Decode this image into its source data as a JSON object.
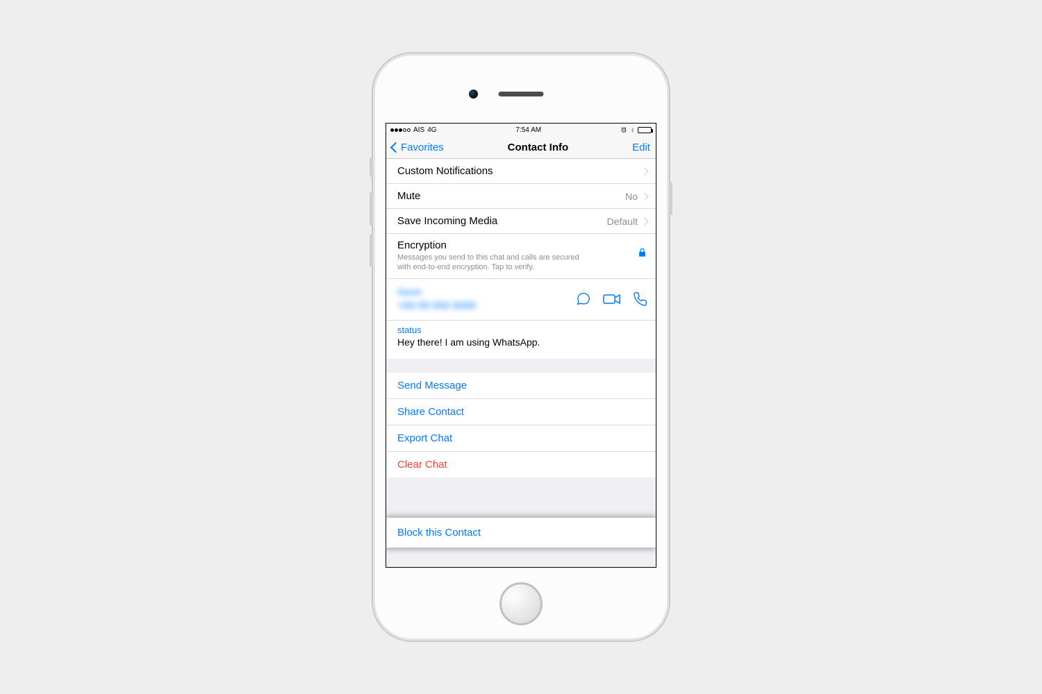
{
  "statusbar": {
    "carrier": "AIS",
    "network": "4G",
    "time": "7:54 AM"
  },
  "nav": {
    "back_label": "Favorites",
    "title": "Contact Info",
    "edit_label": "Edit"
  },
  "settings": {
    "custom_notifications": "Custom Notifications",
    "mute": {
      "label": "Mute",
      "value": "No"
    },
    "save_media": {
      "label": "Save Incoming Media",
      "value": "Default"
    },
    "encryption": {
      "label": "Encryption",
      "description": "Messages you send to this chat and calls are secured with end-to-end encryption. Tap to verify."
    }
  },
  "contact": {
    "name_blurred": "Name",
    "phone_blurred": "+00 00 000 0000"
  },
  "status": {
    "label": "status",
    "text": "Hey there! I am using WhatsApp."
  },
  "actions": {
    "send_message": "Send Message",
    "share_contact": "Share Contact",
    "export_chat": "Export Chat",
    "clear_chat": "Clear Chat",
    "block_contact": "Block this Contact"
  }
}
